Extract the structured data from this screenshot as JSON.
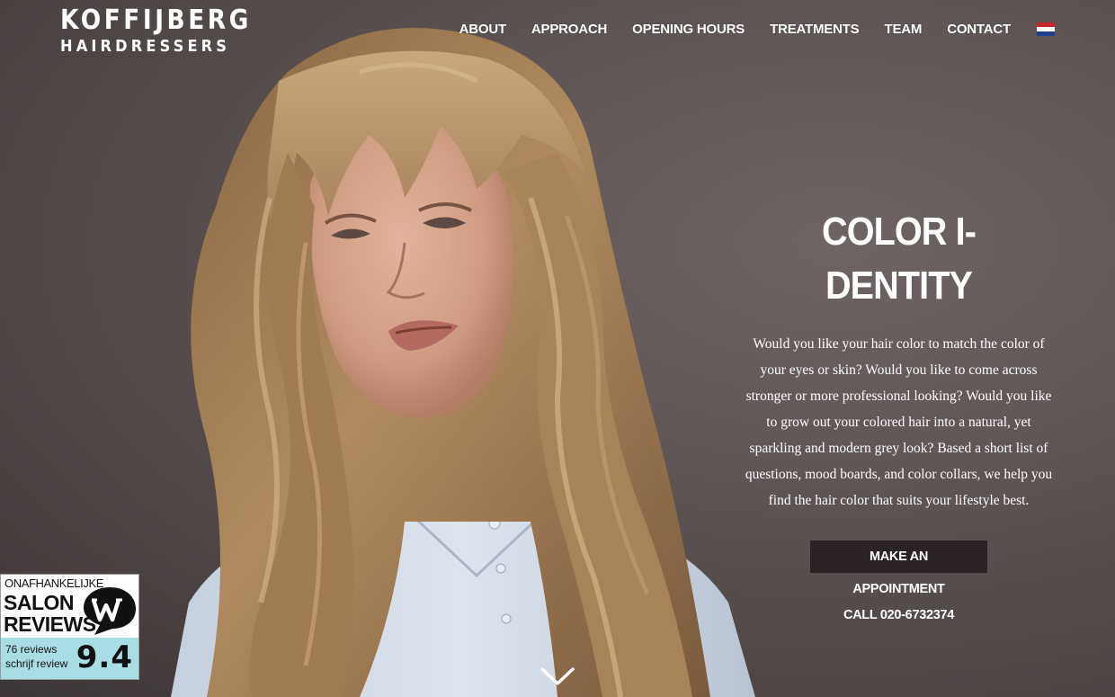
{
  "logo": {
    "line1": "KOFFIJBERG",
    "line2": "HAIRDRESSERS"
  },
  "nav": {
    "items": [
      "ABOUT",
      "APPROACH",
      "OPENING HOURS",
      "TREATMENTS",
      "TEAM",
      "CONTACT"
    ],
    "language_flag": "netherlands-flag-icon"
  },
  "hero": {
    "title": "COLOR I-DENTITY",
    "body": "Would you like your hair color to match the color of your eyes or skin? Would you like to come across stronger or more professional looking? Would you like to grow out your colored hair into a natural, yet sparkling and modern grey look? Based a short list of questions, mood boards, and color collars, we help you find the hair color that suits your lifestyle best.",
    "cta_label": "MAKE AN APPOINTMENT",
    "call_label": "CALL 020-6732374"
  },
  "scroll": {
    "icon": "chevron-down-icon"
  },
  "review_badge": {
    "small_label": "ONAFHANKELIJKE",
    "line1": "SALON",
    "line2": "REVIEWS",
    "icon": "speech-bubble-w-icon",
    "reviews_count": "76 reviews",
    "write_review": "schrijf review",
    "score": "9.4"
  },
  "colors": {
    "background": "#5f5655",
    "cta_background": "#2a2224",
    "badge_accent": "#a9dde4",
    "text": "#ffffff"
  }
}
